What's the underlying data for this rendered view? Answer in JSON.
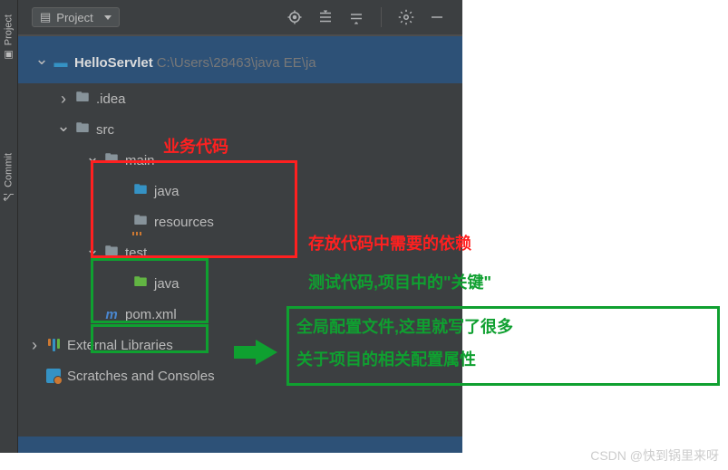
{
  "sidebar": {
    "project_tab": "Project",
    "commit_tab": "Commit"
  },
  "toolbar": {
    "project_label": "Project"
  },
  "tree": {
    "root": {
      "name": "HelloServlet",
      "path": "C:\\Users\\28463\\java EE\\ja"
    },
    "idea": ".idea",
    "src": "src",
    "main": "main",
    "main_java": "java",
    "resources": "resources",
    "test": "test",
    "test_java": "java",
    "pom": "pom.xml",
    "external_libs": "External Libraries",
    "scratches": "Scratches and Consoles"
  },
  "annotations": {
    "business_code": "业务代码",
    "dependencies": "存放代码中需要的依赖",
    "test_code": "测试代码,项目中的\"关键\"",
    "global_config_1": "全局配置文件,这里就写了很多",
    "global_config_2": "关于项目的相关配置属性"
  },
  "watermark": "CSDN @快到锅里来呀"
}
